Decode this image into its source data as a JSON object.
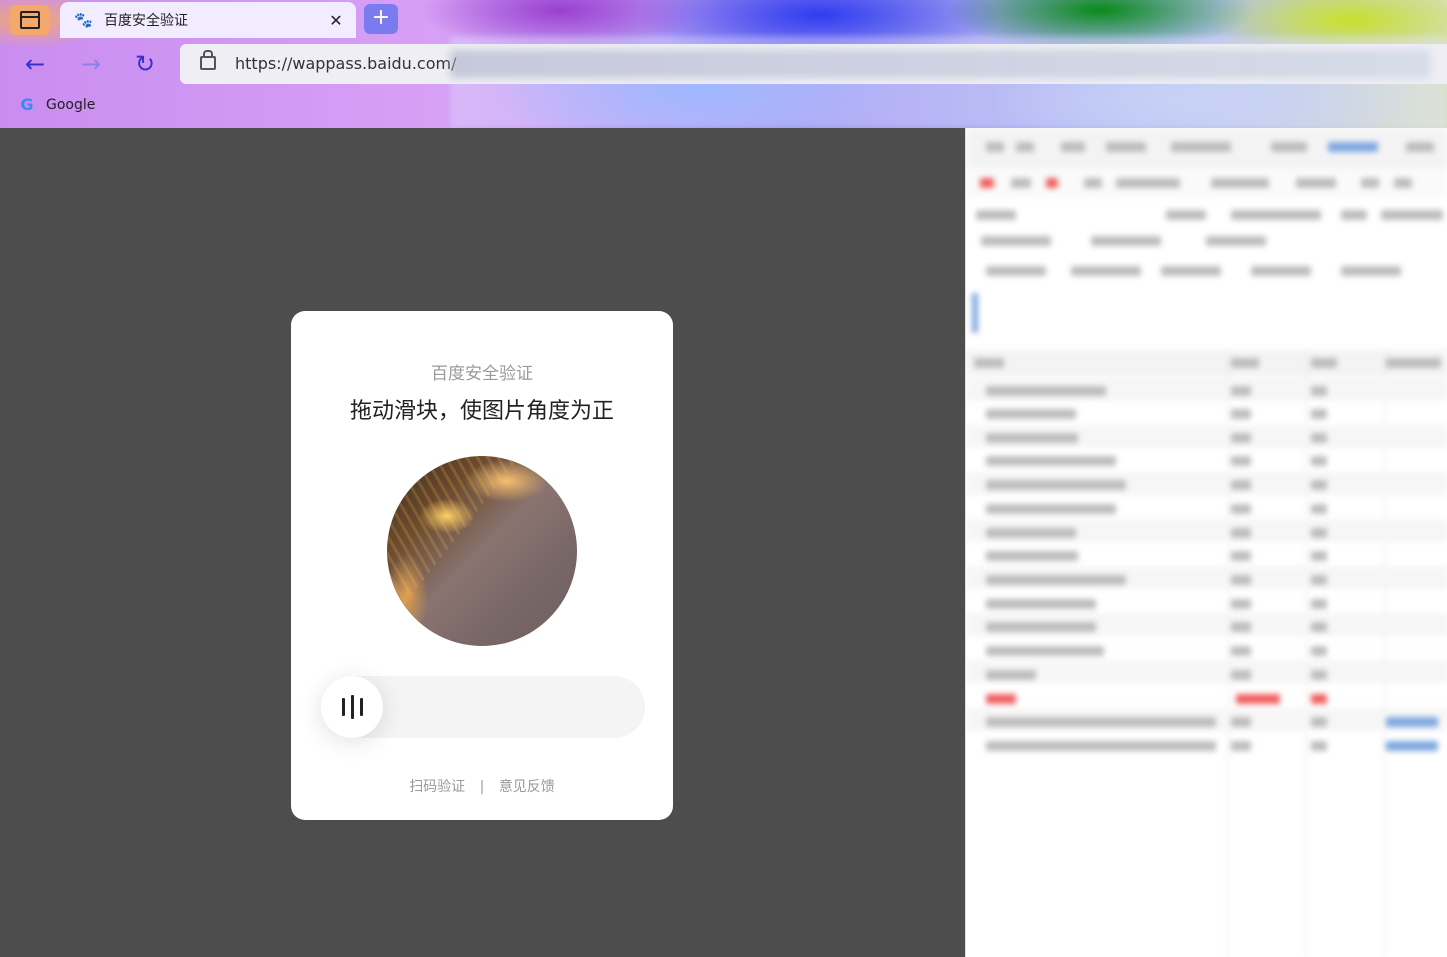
{
  "browser": {
    "tab_title": "百度安全验证",
    "new_tab_label": "+",
    "tab_close_label": "✕",
    "url_prefix": "https://wappass.baidu.com/",
    "bookmarks": [
      {
        "label": "Google",
        "icon": "google-g-icon"
      }
    ],
    "nav": {
      "back_glyph": "←",
      "forward_glyph": "→",
      "reload_glyph": "↻"
    }
  },
  "captcha": {
    "subtitle": "百度安全验证",
    "title": "拖动滑块，使图片角度为正",
    "slider_progress": 0,
    "links": {
      "scan": "扫码验证",
      "separator": "|",
      "feedback": "意见反馈"
    }
  },
  "colors": {
    "page_background": "#4d4d4d",
    "card_background": "#ffffff",
    "slider_track": "#f4f4f4",
    "accent_blue": "#2932e1"
  }
}
